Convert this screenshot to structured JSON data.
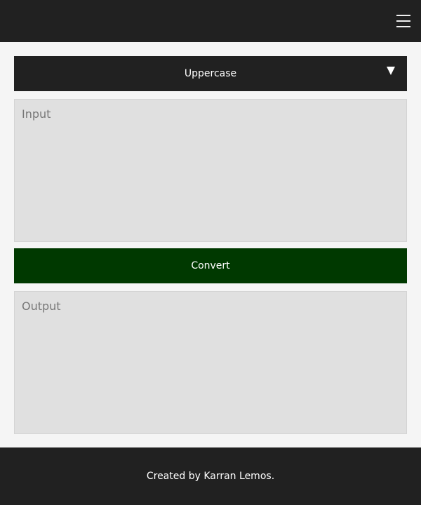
{
  "header": {
    "menu_icon": "hamburger-menu-icon"
  },
  "converter": {
    "mode_label": "Uppercase",
    "input_placeholder": "Input",
    "input_value": "",
    "convert_label": "Convert",
    "output_placeholder": "Output",
    "output_value": ""
  },
  "footer": {
    "text_prefix": "Created by ",
    "author": "Karran Lemos",
    "text_suffix": "."
  },
  "colors": {
    "header_bg": "#212121",
    "page_bg": "#f5f5f5",
    "convert_bg": "#003900",
    "textarea_bg": "#e0e0e0"
  }
}
